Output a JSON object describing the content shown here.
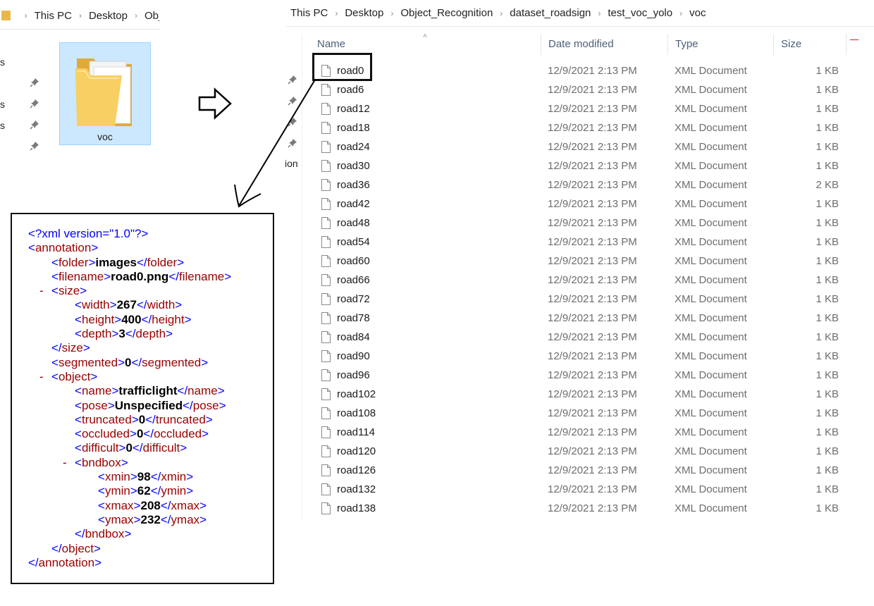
{
  "left_explorer": {
    "breadcrumb": [
      "This PC",
      "Desktop",
      "Obj"
    ],
    "sidebar_fragments": [
      "s",
      "s",
      "s"
    ],
    "selected_folder": {
      "label": "voc",
      "icon": "folder-icon"
    }
  },
  "right_explorer": {
    "breadcrumb": [
      "This PC",
      "Desktop",
      "Object_Recognition",
      "dataset_roadsign",
      "test_voc_yolo",
      "voc"
    ],
    "nav_fragment": "ion",
    "columns": {
      "name": "Name",
      "date": "Date modified",
      "type": "Type",
      "size": "Size"
    },
    "files": [
      {
        "name": "road0",
        "date": "12/9/2021 2:13 PM",
        "type": "XML Document",
        "size": "1 KB"
      },
      {
        "name": "road6",
        "date": "12/9/2021 2:13 PM",
        "type": "XML Document",
        "size": "1 KB"
      },
      {
        "name": "road12",
        "date": "12/9/2021 2:13 PM",
        "type": "XML Document",
        "size": "1 KB"
      },
      {
        "name": "road18",
        "date": "12/9/2021 2:13 PM",
        "type": "XML Document",
        "size": "1 KB"
      },
      {
        "name": "road24",
        "date": "12/9/2021 2:13 PM",
        "type": "XML Document",
        "size": "1 KB"
      },
      {
        "name": "road30",
        "date": "12/9/2021 2:13 PM",
        "type": "XML Document",
        "size": "1 KB"
      },
      {
        "name": "road36",
        "date": "12/9/2021 2:13 PM",
        "type": "XML Document",
        "size": "2 KB"
      },
      {
        "name": "road42",
        "date": "12/9/2021 2:13 PM",
        "type": "XML Document",
        "size": "1 KB"
      },
      {
        "name": "road48",
        "date": "12/9/2021 2:13 PM",
        "type": "XML Document",
        "size": "1 KB"
      },
      {
        "name": "road54",
        "date": "12/9/2021 2:13 PM",
        "type": "XML Document",
        "size": "1 KB"
      },
      {
        "name": "road60",
        "date": "12/9/2021 2:13 PM",
        "type": "XML Document",
        "size": "1 KB"
      },
      {
        "name": "road66",
        "date": "12/9/2021 2:13 PM",
        "type": "XML Document",
        "size": "1 KB"
      },
      {
        "name": "road72",
        "date": "12/9/2021 2:13 PM",
        "type": "XML Document",
        "size": "1 KB"
      },
      {
        "name": "road78",
        "date": "12/9/2021 2:13 PM",
        "type": "XML Document",
        "size": "1 KB"
      },
      {
        "name": "road84",
        "date": "12/9/2021 2:13 PM",
        "type": "XML Document",
        "size": "1 KB"
      },
      {
        "name": "road90",
        "date": "12/9/2021 2:13 PM",
        "type": "XML Document",
        "size": "1 KB"
      },
      {
        "name": "road96",
        "date": "12/9/2021 2:13 PM",
        "type": "XML Document",
        "size": "1 KB"
      },
      {
        "name": "road102",
        "date": "12/9/2021 2:13 PM",
        "type": "XML Document",
        "size": "1 KB"
      },
      {
        "name": "road108",
        "date": "12/9/2021 2:13 PM",
        "type": "XML Document",
        "size": "1 KB"
      },
      {
        "name": "road114",
        "date": "12/9/2021 2:13 PM",
        "type": "XML Document",
        "size": "1 KB"
      },
      {
        "name": "road120",
        "date": "12/9/2021 2:13 PM",
        "type": "XML Document",
        "size": "1 KB"
      },
      {
        "name": "road126",
        "date": "12/9/2021 2:13 PM",
        "type": "XML Document",
        "size": "1 KB"
      },
      {
        "name": "road132",
        "date": "12/9/2021 2:13 PM",
        "type": "XML Document",
        "size": "1 KB"
      },
      {
        "name": "road138",
        "date": "12/9/2021 2:13 PM",
        "type": "XML Document",
        "size": "1 KB"
      }
    ]
  },
  "xml_view": {
    "declaration": "<?xml version=\"1.0\"?>",
    "lines": [
      {
        "indent": 0,
        "minus": false,
        "open": "annotation",
        "value": null,
        "close": null
      },
      {
        "indent": 1,
        "minus": false,
        "open": "folder",
        "value": "images",
        "close": "folder"
      },
      {
        "indent": 1,
        "minus": false,
        "open": "filename",
        "value": "road0.png",
        "close": "filename"
      },
      {
        "indent": 1,
        "minus": true,
        "open": "size",
        "value": null,
        "close": null
      },
      {
        "indent": 2,
        "minus": false,
        "open": "width",
        "value": "267",
        "close": "width"
      },
      {
        "indent": 2,
        "minus": false,
        "open": "height",
        "value": "400",
        "close": "height"
      },
      {
        "indent": 2,
        "minus": false,
        "open": "depth",
        "value": "3",
        "close": "depth"
      },
      {
        "indent": 1,
        "minus": false,
        "open": null,
        "value": null,
        "close": "size"
      },
      {
        "indent": 1,
        "minus": false,
        "open": "segmented",
        "value": "0",
        "close": "segmented"
      },
      {
        "indent": 1,
        "minus": true,
        "open": "object",
        "value": null,
        "close": null
      },
      {
        "indent": 2,
        "minus": false,
        "open": "name",
        "value": "trafficlight",
        "close": "name"
      },
      {
        "indent": 2,
        "minus": false,
        "open": "pose",
        "value": "Unspecified",
        "close": "pose"
      },
      {
        "indent": 2,
        "minus": false,
        "open": "truncated",
        "value": "0",
        "close": "truncated"
      },
      {
        "indent": 2,
        "minus": false,
        "open": "occluded",
        "value": "0",
        "close": "occluded"
      },
      {
        "indent": 2,
        "minus": false,
        "open": "difficult",
        "value": "0",
        "close": "difficult"
      },
      {
        "indent": 2,
        "minus": true,
        "open": "bndbox",
        "value": null,
        "close": null
      },
      {
        "indent": 3,
        "minus": false,
        "open": "xmin",
        "value": "98",
        "close": "xmin"
      },
      {
        "indent": 3,
        "minus": false,
        "open": "ymin",
        "value": "62",
        "close": "ymin"
      },
      {
        "indent": 3,
        "minus": false,
        "open": "xmax",
        "value": "208",
        "close": "xmax"
      },
      {
        "indent": 3,
        "minus": false,
        "open": "ymax",
        "value": "232",
        "close": "ymax"
      },
      {
        "indent": 2,
        "minus": false,
        "open": null,
        "value": null,
        "close": "bndbox"
      },
      {
        "indent": 1,
        "minus": false,
        "open": null,
        "value": null,
        "close": "object"
      },
      {
        "indent": 0,
        "minus": false,
        "open": null,
        "value": null,
        "close": "annotation"
      }
    ]
  },
  "colors": {
    "selection_fill": "#cce8ff",
    "selection_border": "#99d1ff",
    "folder_yellow": "#e8b94a",
    "xml_bracket_blue": "#0000ff",
    "xml_tag_red": "#990000"
  }
}
